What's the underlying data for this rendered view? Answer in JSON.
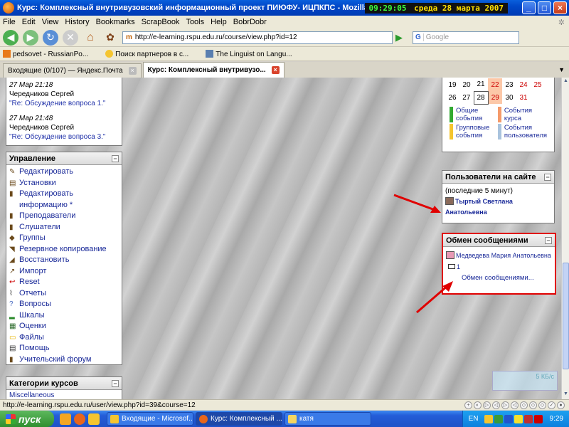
{
  "window": {
    "title": "Курс: Комплексный внутривузовский информационный проект ПИЮФУ- ИЦПКПС - Mozilla Firefox",
    "clock_time": "09:29:05",
    "clock_date": "среда 28 марта 2007"
  },
  "menu": [
    "File",
    "Edit",
    "View",
    "History",
    "Bookmarks",
    "ScrapBook",
    "Tools",
    "Help",
    "BobrDobr"
  ],
  "nav": {
    "url": "http://e-learning.rspu.edu.ru/course/view.php?id=12",
    "search_placeholder": "Google",
    "search_engine": "G"
  },
  "bookmarks": [
    "pedsovet - RussianPo...",
    "Поиск партнеров в с...",
    "The Linguist on Langu..."
  ],
  "tabs": [
    {
      "label": "Входящие (0/107) — Яндекс.Почта",
      "active": false
    },
    {
      "label": "Курс: Комплексный внутривузо...",
      "active": true
    }
  ],
  "discussion": {
    "items": [
      {
        "date": "27 Мар 21:18",
        "author": "Чередников Сергей",
        "link": "\"Re: Обсуждение вопроса 1.\""
      },
      {
        "date": "27 Мар 21:48",
        "author": "Чередников Сергей",
        "link": "\"Re: Обсуждение вопроса 3.\""
      }
    ]
  },
  "management": {
    "title": "Управление",
    "items": [
      "Редактировать",
      "Установки",
      "Редактировать информацию *",
      "Преподаватели",
      "Слушатели",
      "Группы",
      "Резервное копирование",
      "Восстановить",
      "Импорт",
      "Reset",
      "Отчеты",
      "Вопросы",
      "Шкалы",
      "Оценки",
      "Файлы",
      "Помощь",
      "Учительский форум"
    ]
  },
  "categories": {
    "title": "Категории курсов",
    "sub": "Miscellaneous"
  },
  "calendar": {
    "rows": [
      [
        "19",
        "20",
        "21",
        "22",
        "23",
        "24",
        "25"
      ],
      [
        "26",
        "27",
        "28",
        "29",
        "30",
        "31",
        ""
      ]
    ],
    "legend": [
      {
        "label": "Общие события",
        "color": "#33aa33"
      },
      {
        "label": "События курса",
        "color": "#f59a6a"
      },
      {
        "label": "Групповые события",
        "color": "#f5c530"
      },
      {
        "label": "События пользователя",
        "color": "#a9c3dd"
      }
    ]
  },
  "online": {
    "title": "Пользователи на сайте",
    "subtitle": "(последние 5 минут)",
    "user": "Тыртый Светлана Анатольевна"
  },
  "messages": {
    "title": "Обмен сообщениями",
    "user": "Медведева Мария Анатольевна",
    "count": "1",
    "link": "Обмен сообщениями..."
  },
  "kb": {
    "label": "5 КБ/с"
  },
  "status": {
    "url": "http://e-learning.rspu.edu.ru/user/view.php?id=39&course=12"
  },
  "taskbar": {
    "start": "пуск",
    "buttons": [
      {
        "label": "Входящие - Microsof...",
        "active": false
      },
      {
        "label": "Курс: Комплексный ...",
        "active": true
      },
      {
        "label": "катя",
        "active": false
      }
    ],
    "lang": "EN",
    "time": "9:29"
  }
}
